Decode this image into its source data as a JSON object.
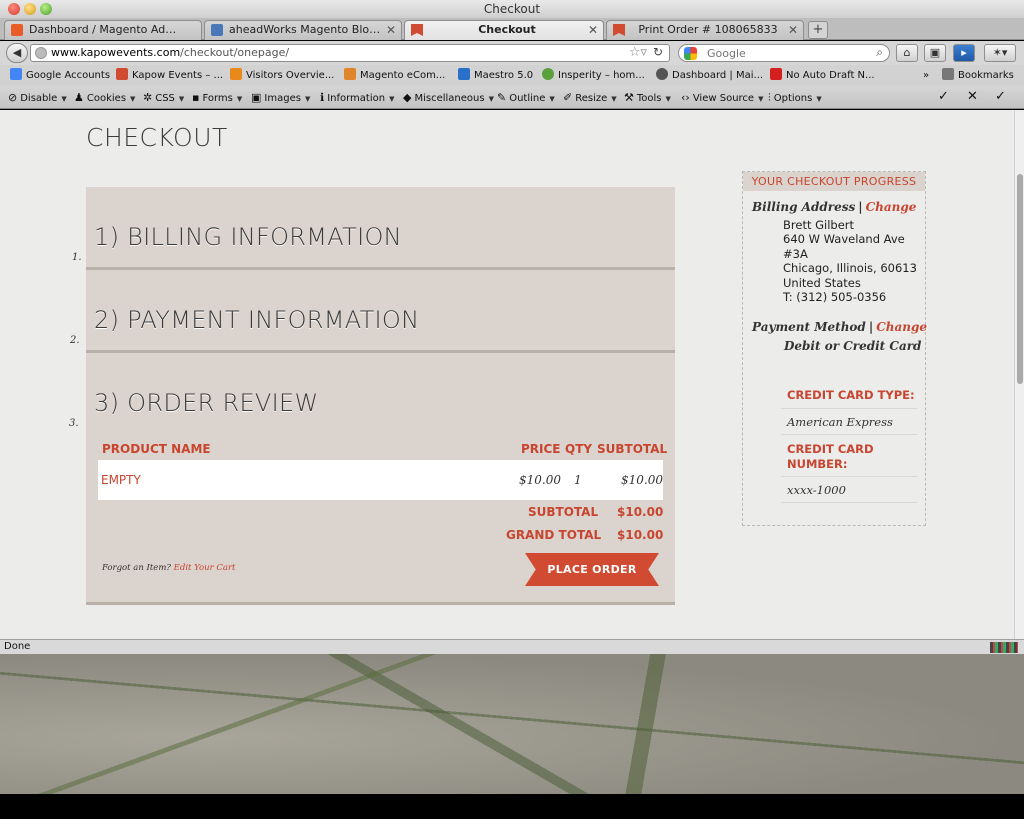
{
  "window": {
    "title": "Checkout"
  },
  "tabs": [
    {
      "label": "Dashboard / Magento Admin",
      "favicon_color": "#e85d27"
    },
    {
      "label": "aheadWorks Magento Blog » We...",
      "favicon_color": "#4a78b8"
    },
    {
      "label": "Checkout",
      "favicon_color": "#d14b32",
      "active": true
    },
    {
      "label": "Print Order # 108065833",
      "favicon_color": "#d14b32"
    }
  ],
  "nav": {
    "url_domain": "www.kapowevents.com",
    "url_path": "/checkout/onepage/",
    "search_placeholder": "Google"
  },
  "bookmarks": [
    {
      "label": "Google Accounts",
      "icon": "google-g-icon",
      "color": "#4285f4"
    },
    {
      "label": "Kapow Events – ...",
      "icon": "kapow-flag-icon",
      "color": "#d14b32"
    },
    {
      "label": "Visitors Overvie...",
      "icon": "analytics-icon",
      "color": "#e8891c"
    },
    {
      "label": "Magento eCom...",
      "icon": "magento-icon",
      "color": "#e0852a"
    },
    {
      "label": "Maestro 5.0",
      "icon": "maestro-x-icon",
      "color": "#2a6fc9"
    },
    {
      "label": "Insperity – hom...",
      "icon": "insperity-icon",
      "color": "#5aa03c"
    },
    {
      "label": "Dashboard | Mai...",
      "icon": "mailchimp-icon",
      "color": "#555555"
    },
    {
      "label": "No Auto Draft N...",
      "icon": "e-icon",
      "color": "#d6201f"
    },
    {
      "label": "Bookmarks",
      "icon": "bookmarks-icon",
      "color": "#555555"
    }
  ],
  "devbar": [
    {
      "label": "Disable",
      "icon": "⊘"
    },
    {
      "label": "Cookies",
      "icon": "♟"
    },
    {
      "label": "CSS",
      "icon": "✲"
    },
    {
      "label": "Forms",
      "icon": "▪"
    },
    {
      "label": "Images",
      "icon": "▣"
    },
    {
      "label": "Information",
      "icon": "ℹ"
    },
    {
      "label": "Miscellaneous",
      "icon": "◆"
    },
    {
      "label": "Outline",
      "icon": "✎"
    },
    {
      "label": "Resize",
      "icon": "✐"
    },
    {
      "label": "Tools",
      "icon": "⚒"
    },
    {
      "label": "View Source",
      "icon": "‹›"
    },
    {
      "label": "Options",
      "icon": "⫶"
    }
  ],
  "page": {
    "title": "CHECKOUT",
    "steps": [
      {
        "num": "1.",
        "title": "1) BILLING INFORMATION"
      },
      {
        "num": "2.",
        "title": "2) PAYMENT INFORMATION"
      },
      {
        "num": "3.",
        "title": "3) ORDER REVIEW"
      }
    ],
    "table": {
      "headers": {
        "product": "PRODUCT NAME",
        "price": "PRICE",
        "qty": "QTY",
        "subtotal": "SUBTOTAL"
      },
      "row": {
        "product": "EMPTY",
        "price": "$10.00",
        "qty": "1",
        "subtotal": "$10.00"
      }
    },
    "totals": {
      "subtotal_label": "SUBTOTAL",
      "subtotal_value": "$10.00",
      "grand_label": "GRAND TOTAL",
      "grand_value": "$10.00"
    },
    "forgot_text": "Forgot an Item?",
    "edit_cart": "Edit Your Cart",
    "place_order": "PLACE ORDER"
  },
  "progress": {
    "heading": "YOUR CHECKOUT PROGRESS",
    "billing_label": "Billing Address",
    "change": "Change",
    "address": [
      "Brett Gilbert",
      "640 W Waveland Ave",
      "#3A",
      "Chicago, Illinois, 60613",
      "United States",
      "T: (312) 505-0356"
    ],
    "payment_label": "Payment Method",
    "payment_value": "Debit or Credit Card",
    "cc_type_label": "CREDIT CARD TYPE:",
    "cc_type_value": "American Express",
    "cc_number_label_1": "CREDIT CARD",
    "cc_number_label_2": "NUMBER:",
    "cc_number_value": "xxxx-1000"
  },
  "status": {
    "text": "Done"
  },
  "colors": {
    "accent": "#c8452f",
    "panel": "#dbd3cd"
  }
}
